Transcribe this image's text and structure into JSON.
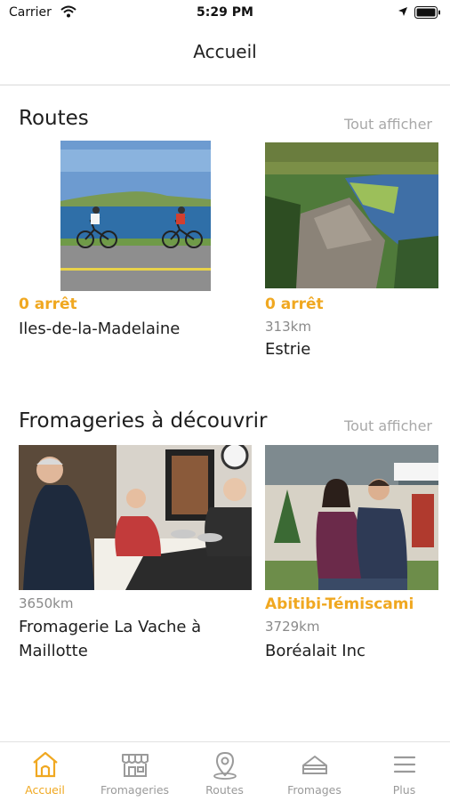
{
  "status_bar": {
    "carrier": "Carrier",
    "time": "5:29 PM"
  },
  "nav": {
    "title": "Accueil"
  },
  "routes": {
    "title": "Routes",
    "see_all": "Tout afficher",
    "items": [
      {
        "stops": "0 arrêt",
        "name": "Iles-de-la-Madelaine"
      },
      {
        "stops": "0 arrêt",
        "distance": "313km",
        "name": "Estrie"
      }
    ]
  },
  "fromageries": {
    "title": "Fromageries à découvrir",
    "see_all": "Tout afficher",
    "items": [
      {
        "distance": "3650km",
        "name": "Fromagerie La Vache à Maillotte"
      },
      {
        "region": "Abitibi-Témiscami",
        "distance": "3729km",
        "name": "Boréalait Inc"
      }
    ]
  },
  "tabs": [
    {
      "label": "Accueil",
      "icon": "home-icon",
      "active": true
    },
    {
      "label": "Fromageries",
      "icon": "shop-icon",
      "active": false
    },
    {
      "label": "Routes",
      "icon": "map-pin-icon",
      "active": false
    },
    {
      "label": "Fromages",
      "icon": "cheese-icon",
      "active": false
    },
    {
      "label": "Plus",
      "icon": "menu-icon",
      "active": false
    }
  ],
  "colors": {
    "accent": "#f0a821",
    "muted": "#a8a8a8",
    "text": "#1e1e1e"
  }
}
